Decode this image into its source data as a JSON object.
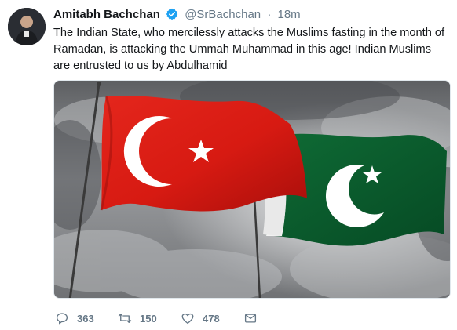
{
  "tweet": {
    "author_name": "Amitabh Bachchan",
    "handle": "@SrBachchan",
    "separator": "·",
    "time": "18m",
    "text": "The Indian State, who mercilessly attacks the Muslims fasting in the month of Ramadan, is attacking the Ummah Muhammad in this age! Indian Muslims are entrusted to us by Abdulhamid",
    "media_description_icon": "image-turkey-pakistan-flags",
    "verified_icon": "verified-badge-icon"
  },
  "actions": {
    "reply_count": "363",
    "retweet_count": "150",
    "like_count": "478",
    "reply_icon": "reply-icon",
    "retweet_icon": "retweet-icon",
    "like_icon": "heart-icon",
    "dm_icon": "envelope-icon"
  },
  "colors": {
    "verified": "#1da1f2",
    "secondary_text": "#657786",
    "turkey_red": "#e30a17",
    "pakistan_green": "#01411c"
  }
}
